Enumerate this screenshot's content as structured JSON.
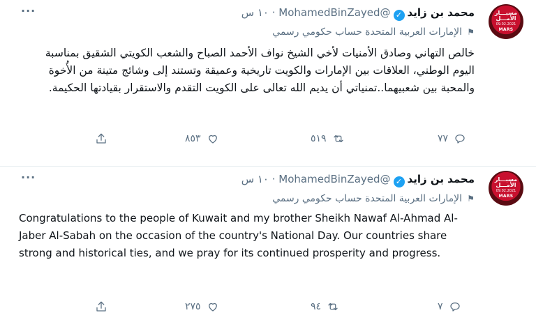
{
  "tweets": [
    {
      "author_name": "محمد بن زايد",
      "handle": "@MohamedBinZayed",
      "separator": "·",
      "time": "١٠ س",
      "account_label": "الإمارات العربية المتحدة حساب حكومي رسمي",
      "avatar_text_ar": "مسبـــار الأمـــل",
      "avatar_text_en": "MARS",
      "avatar_date": "09.02.2021",
      "text": "خالص التهاني وصادق الأمنيات لأخي الشيخ نواف الأحمد الصباح والشعب الكويتي الشقيق بمناسبة اليوم الوطني، العلاقات بين الإمارات والكويت تاريخية وعميقة وتستند إلى وشائج متينة من الأُخوة والمحبة بين شعبيهما..تمنياتي أن يديم الله تعالى على الكويت التقدم والاستقرار بقيادتها الحكيمة.",
      "direction": "rtl",
      "replies": "٧٧",
      "retweets": "٥١٩",
      "likes": "٨٥٣"
    },
    {
      "author_name": "محمد بن زايد",
      "handle": "@MohamedBinZayed",
      "separator": "·",
      "time": "١٠ س",
      "account_label": "الإمارات العربية المتحدة حساب حكومي رسمي",
      "avatar_text_ar": "مسبـــار الأمـــل",
      "avatar_text_en": "MARS",
      "avatar_date": "09.02.2021",
      "text": "Congratulations to the people of Kuwait and my brother Sheikh Nawaf Al-Ahmad Al-Jaber Al-Sabah on the occasion of the country's National Day. Our countries share strong and historical ties, and we pray for its continued prosperity and progress.",
      "direction": "ltr",
      "replies": "٧",
      "retweets": "٩٤",
      "likes": "٢٧٥"
    }
  ],
  "icons": {
    "verified": "verified-badge-icon",
    "label": "government-flag-icon",
    "reply": "reply-icon",
    "retweet": "retweet-icon",
    "like": "heart-icon",
    "share": "share-icon",
    "more": "more-icon"
  },
  "colors": {
    "verified": "#1da1f2",
    "secondary_text": "#5b7083",
    "avatar": "#c8102e"
  }
}
